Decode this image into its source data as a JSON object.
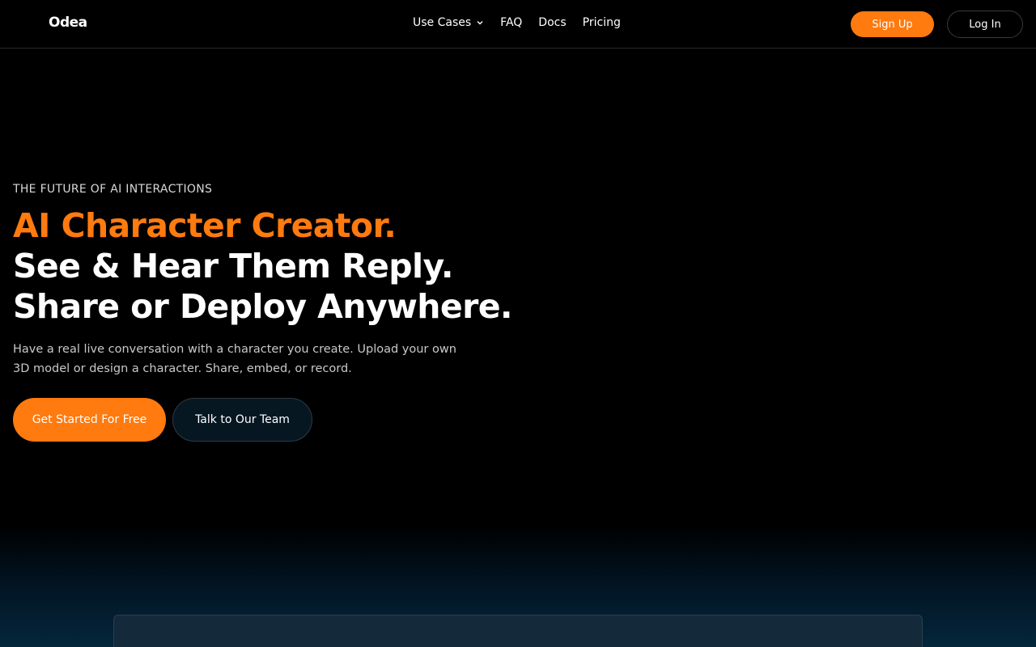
{
  "header": {
    "logo": "Odea",
    "nav": [
      {
        "label": "Use Cases",
        "has_dropdown": true
      },
      {
        "label": "FAQ"
      },
      {
        "label": "Docs"
      },
      {
        "label": "Pricing"
      }
    ],
    "signup_label": "Sign Up",
    "login_label": "Log In"
  },
  "hero": {
    "eyebrow": "THE FUTURE OF AI INTERACTIONS",
    "headline": [
      "AI Character Creator.",
      "See & Hear Them Reply.",
      "Share or Deploy Anywhere."
    ],
    "description": "Have a real live conversation with a character you create. Upload your own 3D model or design a character. Share, embed, or record.",
    "primary_cta": "Get Started For Free",
    "secondary_cta": "Talk to Our Team"
  },
  "colors": {
    "accent": "#ff7a0f",
    "background": "#000000",
    "panel": "#14293a"
  },
  "icons": {
    "dropdown": "chevron-down-icon"
  }
}
